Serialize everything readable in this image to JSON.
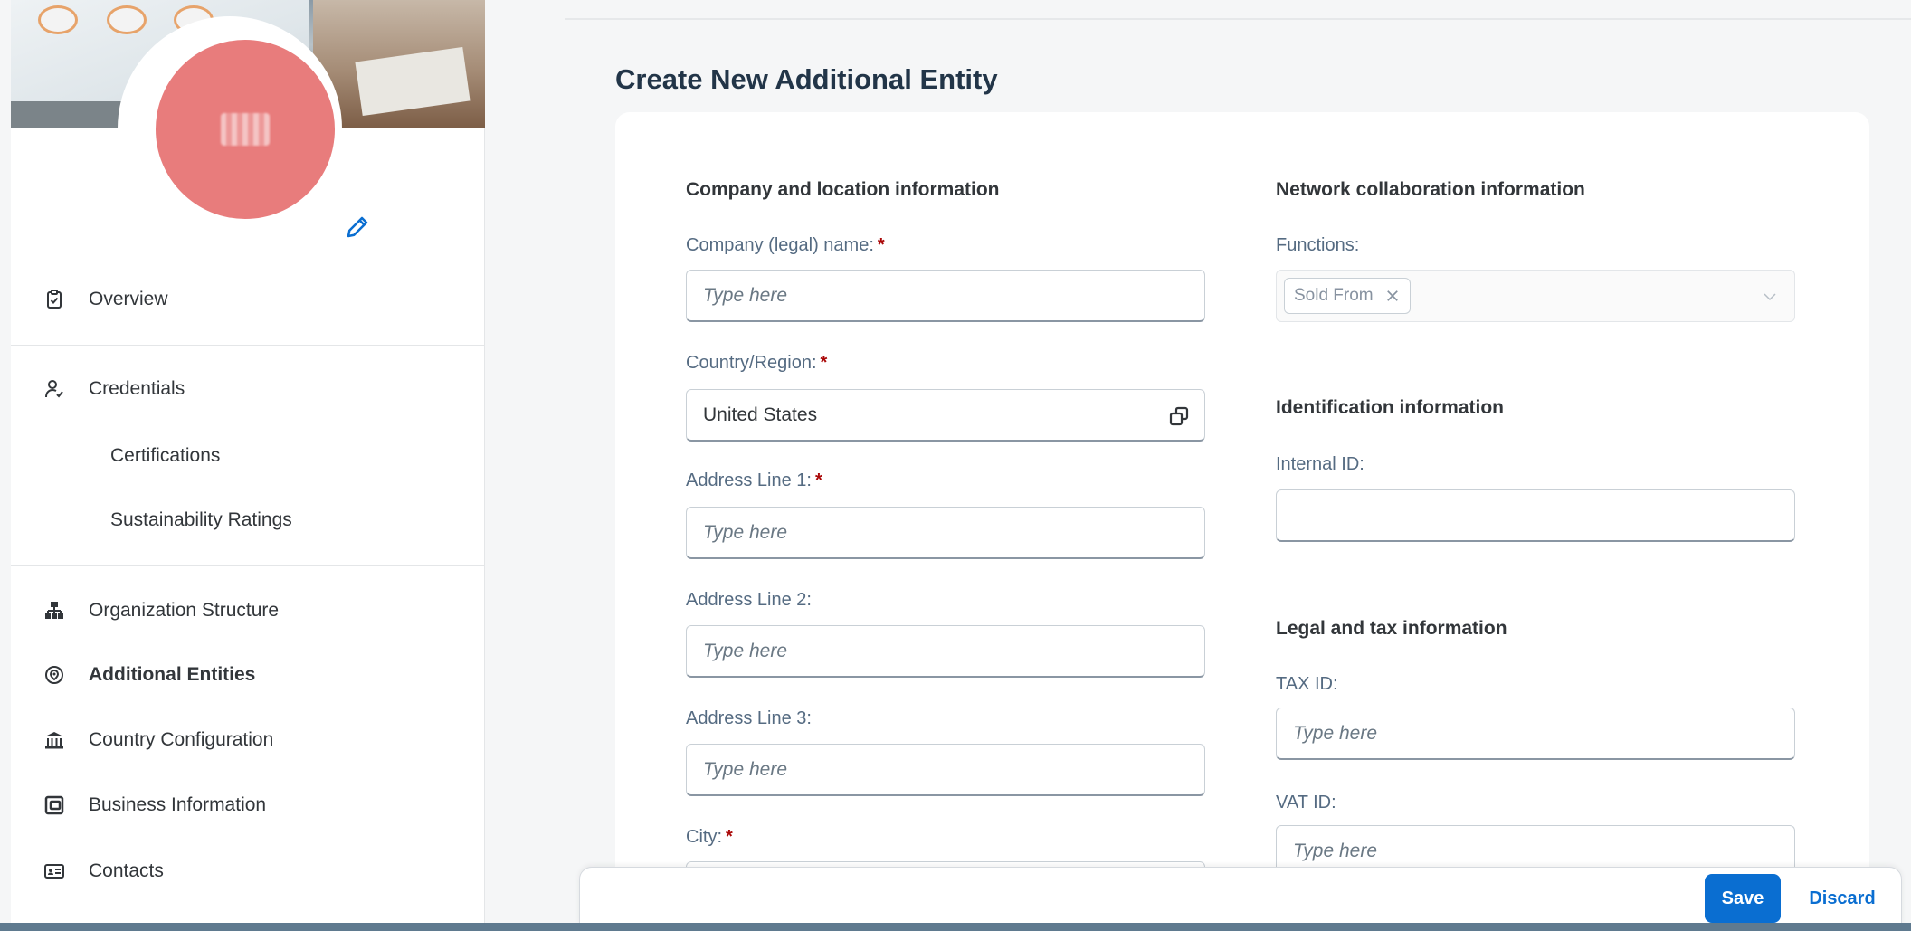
{
  "page": {
    "title": "Create New Additional Entity"
  },
  "sidebar": {
    "items": [
      {
        "label": "Overview",
        "icon": "clipboard-check-icon"
      },
      {
        "label": "Credentials",
        "icon": "user-check-icon"
      },
      {
        "label": "Certifications"
      },
      {
        "label": "Sustainability Ratings"
      },
      {
        "label": "Organization Structure",
        "icon": "org-chart-icon"
      },
      {
        "label": "Additional Entities",
        "icon": "location-pin-icon",
        "active": true
      },
      {
        "label": "Country Configuration",
        "icon": "bank-icon"
      },
      {
        "label": "Business Information",
        "icon": "wallet-icon"
      },
      {
        "label": "Contacts",
        "icon": "contact-card-icon"
      }
    ]
  },
  "form": {
    "company_section": "Company and location information",
    "company_name": {
      "label": "Company (legal) name:",
      "placeholder": "Type here"
    },
    "country": {
      "label": "Country/Region:",
      "value": "United States"
    },
    "address1": {
      "label": "Address Line 1:",
      "placeholder": "Type here"
    },
    "address2": {
      "label": "Address Line 2:",
      "placeholder": "Type here"
    },
    "address3": {
      "label": "Address Line 3:",
      "placeholder": "Type here"
    },
    "city": {
      "label": "City:"
    },
    "network_section": "Network collaboration information",
    "functions": {
      "label": "Functions:",
      "token": "Sold From"
    },
    "identification_section": "Identification information",
    "internal_id": {
      "label": "Internal ID:",
      "value": ""
    },
    "legal_section": "Legal and tax information",
    "tax_id": {
      "label": "TAX ID:",
      "placeholder": "Type here"
    },
    "vat_id": {
      "label": "VAT ID:",
      "placeholder": "Type here"
    }
  },
  "footer": {
    "save_label": "Save",
    "discard_label": "Discard"
  },
  "colors": {
    "accent": "#0a6ed1",
    "avatar": "#e87c7c",
    "required": "#aa0808"
  }
}
